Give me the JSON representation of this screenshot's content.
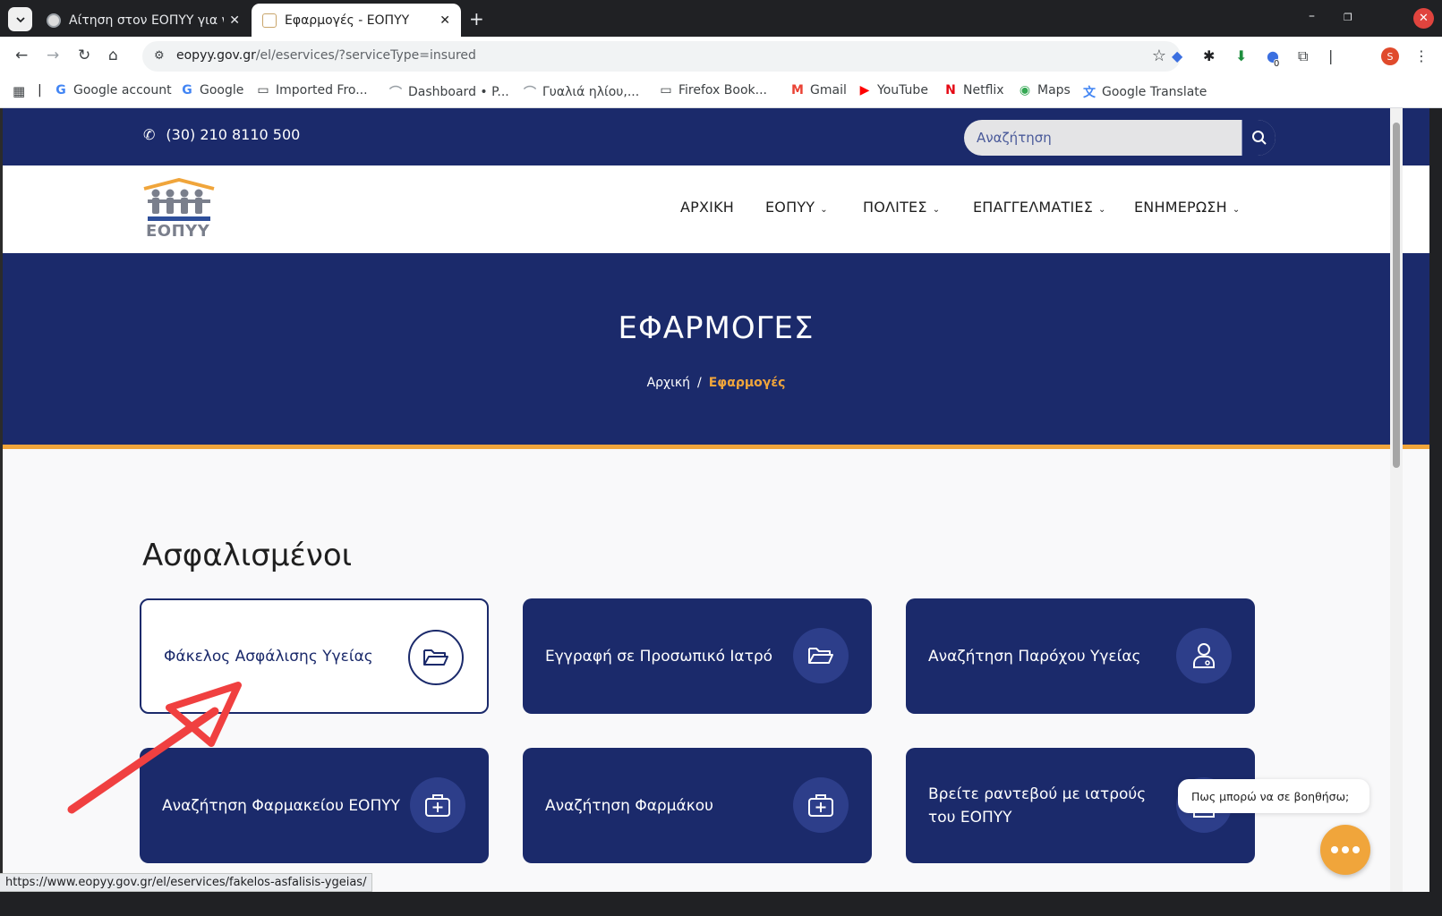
{
  "browser": {
    "tabs": [
      {
        "title": "Αίτηση στον ΕΟΠΥΥ για ν",
        "active": false
      },
      {
        "title": "Εφαρμογές - ΕΟΠΥΥ",
        "active": true
      }
    ],
    "url_domain": "eopyy.gov.gr",
    "url_path": "/el/eservices/?serviceType=insured",
    "extension_badge": "0",
    "avatar_letter": "S",
    "bookmarks": [
      {
        "label": "Google account",
        "icon": "google-icon"
      },
      {
        "label": "Google",
        "icon": "google-icon"
      },
      {
        "label": "Imported Fro...",
        "icon": "folder-icon"
      },
      {
        "label": "Dashboard • P...",
        "icon": "site-icon"
      },
      {
        "label": "Γυαλιά ηλίου,...",
        "icon": "site-icon"
      },
      {
        "label": "Firefox Book...",
        "icon": "folder-icon"
      },
      {
        "label": "Gmail",
        "icon": "gmail-icon"
      },
      {
        "label": "YouTube",
        "icon": "youtube-icon"
      },
      {
        "label": "Netflix",
        "icon": "netflix-icon"
      },
      {
        "label": "Maps",
        "icon": "maps-icon"
      },
      {
        "label": "Google Translate",
        "icon": "translate-icon"
      }
    ],
    "status_url": "https://www.eopyy.gov.gr/el/eservices/fakelos-asfalisis-ygeias/"
  },
  "site": {
    "phone": "(30) 210 8110 500",
    "search_placeholder": "Αναζήτηση",
    "logo_text": "ΕΟΠΥΥ",
    "nav": [
      {
        "label": "ΑΡΧΙΚΗ",
        "dropdown": false
      },
      {
        "label": "ΕΟΠΥΥ",
        "dropdown": true
      },
      {
        "label": "ΠΟΛΙΤΕΣ",
        "dropdown": true
      },
      {
        "label": "ΕΠΑΓΓΕΛΜΑΤΙΕΣ",
        "dropdown": true
      },
      {
        "label": "ΕΝΗΜΕΡΩΣΗ",
        "dropdown": true
      }
    ],
    "hero": {
      "title": "ΕΦΑΡΜΟΓΕΣ",
      "breadcrumb_home": "Αρχική",
      "breadcrumb_sep": "/",
      "breadcrumb_current": "Εφαρμογές"
    },
    "section_title": "Ασφαλισμένοι",
    "cards": [
      {
        "label": "Φάκελος Ασφάλισης Υγείας",
        "icon": "folder-open-icon",
        "highlighted": true
      },
      {
        "label": "Εγγραφή σε Προσωπικό Ιατρό",
        "icon": "folder-open-icon",
        "highlighted": false
      },
      {
        "label": "Αναζήτηση Παρόχου Υγείας",
        "icon": "doctor-icon",
        "highlighted": false
      },
      {
        "label": "Αναζήτηση Φαρμακείου ΕΟΠΥΥ",
        "icon": "medkit-icon",
        "highlighted": false
      },
      {
        "label": "Αναζήτηση Φαρμάκου",
        "icon": "medkit-icon",
        "highlighted": false
      },
      {
        "label": "Βρείτε ραντεβού με ιατρούς του ΕΟΠΥΥ",
        "icon": "doctor-icon",
        "highlighted": false
      }
    ],
    "chat_prompt": "Πως μπορώ να σε βοηθήσω;"
  },
  "colors": {
    "primary": "#1b2a6b",
    "accent": "#f0a53b",
    "annotation_arrow": "#f04040"
  }
}
